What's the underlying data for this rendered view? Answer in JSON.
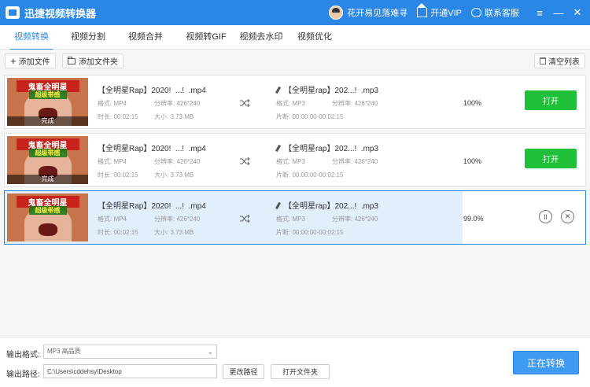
{
  "app": {
    "title": "迅捷视频转换器"
  },
  "titlebar": {
    "username": "花开易见落难寻",
    "vip_label": "开通VIP",
    "service_label": "联系客服",
    "window_controls": [
      "menu-icon",
      "minimize-icon",
      "close-icon"
    ]
  },
  "tabs": [
    {
      "label": "视频转换",
      "active": true
    },
    {
      "label": "视频分割",
      "active": false
    },
    {
      "label": "视频合并",
      "active": false
    },
    {
      "label": "视频转GIF",
      "active": false
    },
    {
      "label": "视频去水印",
      "active": false
    },
    {
      "label": "视频优化",
      "active": false
    }
  ],
  "toolbar": {
    "add_file": "添加文件",
    "add_folder": "添加文件夹",
    "clear_list": "清空列表"
  },
  "files": [
    {
      "thumb_text1": "鬼畜全明星",
      "thumb_text2": "超级带感",
      "thumb_status": "完成",
      "src_name": "【全明星Rap】2020!  ...!  .mp4",
      "src_format_label": "格式:",
      "src_format": "MP4",
      "src_res_label": "分辨率:",
      "src_res": "426*240",
      "src_dur_label": "时长:",
      "src_dur": "00:02:15",
      "src_size_label": "大小:",
      "src_size": "3.73 MB",
      "dst_name": "【全明星rap】202...!  .mp3",
      "dst_format_label": "格式:",
      "dst_format": "MP3",
      "dst_res_label": "分辨率:",
      "dst_res": "426*240",
      "dst_seg_label": "片断:",
      "dst_seg": "00:00:00-00:02:15",
      "progress_text": "100%",
      "progress": 1.0,
      "action": "打开",
      "state": "done"
    },
    {
      "thumb_text1": "鬼畜全明星",
      "thumb_text2": "超级带感",
      "thumb_status": "完成",
      "src_name": "【全明星Rap】2020!  ...!  .mp4",
      "src_format_label": "格式:",
      "src_format": "MP4",
      "src_res_label": "分辨率:",
      "src_res": "426*240",
      "src_dur_label": "时长:",
      "src_dur": "00:02:15",
      "src_size_label": "大小:",
      "src_size": "3.73 MB",
      "dst_name": "【全明星rap】202...!  .mp3",
      "dst_format_label": "格式:",
      "dst_format": "MP3",
      "dst_res_label": "分辨率:",
      "dst_res": "426*240",
      "dst_seg_label": "片断:",
      "dst_seg": "00:00:00-00:02:15",
      "progress_text": "100%",
      "progress": 1.0,
      "action": "打开",
      "state": "done"
    },
    {
      "thumb_text1": "鬼畜全明星",
      "thumb_text2": "超级带感",
      "thumb_status": "",
      "src_name": "【全明星Rap】2020!  ...!  .mp4",
      "src_format_label": "格式:",
      "src_format": "MP4",
      "src_res_label": "分辨率:",
      "src_res": "426*240",
      "src_dur_label": "时长:",
      "src_dur": "00:02:15",
      "src_size_label": "大小:",
      "src_size": "3.73 MB",
      "dst_name": "【全明星rap】202...!  .mp3",
      "dst_format_label": "格式:",
      "dst_format": "MP3",
      "dst_res_label": "分辨率:",
      "dst_res": "426*240",
      "dst_seg_label": "片断:",
      "dst_seg": "00:00:00-00:02:15",
      "progress_text": "99.0%",
      "progress": 0.99,
      "state": "converting"
    }
  ],
  "output": {
    "format_label": "输出格式:",
    "format_value": "MP3  高品质",
    "path_label": "输出路径:",
    "path_value": "C:\\Users\\cddehsy\\Desktop",
    "change_path": "更改路径",
    "open_folder": "打开文件夹",
    "convert_button": "正在转换"
  },
  "colors": {
    "accent": "#2b87e6",
    "open_button": "#20c03a",
    "progress_fill": "#e1eefb",
    "convert_button": "#3f9af2"
  }
}
